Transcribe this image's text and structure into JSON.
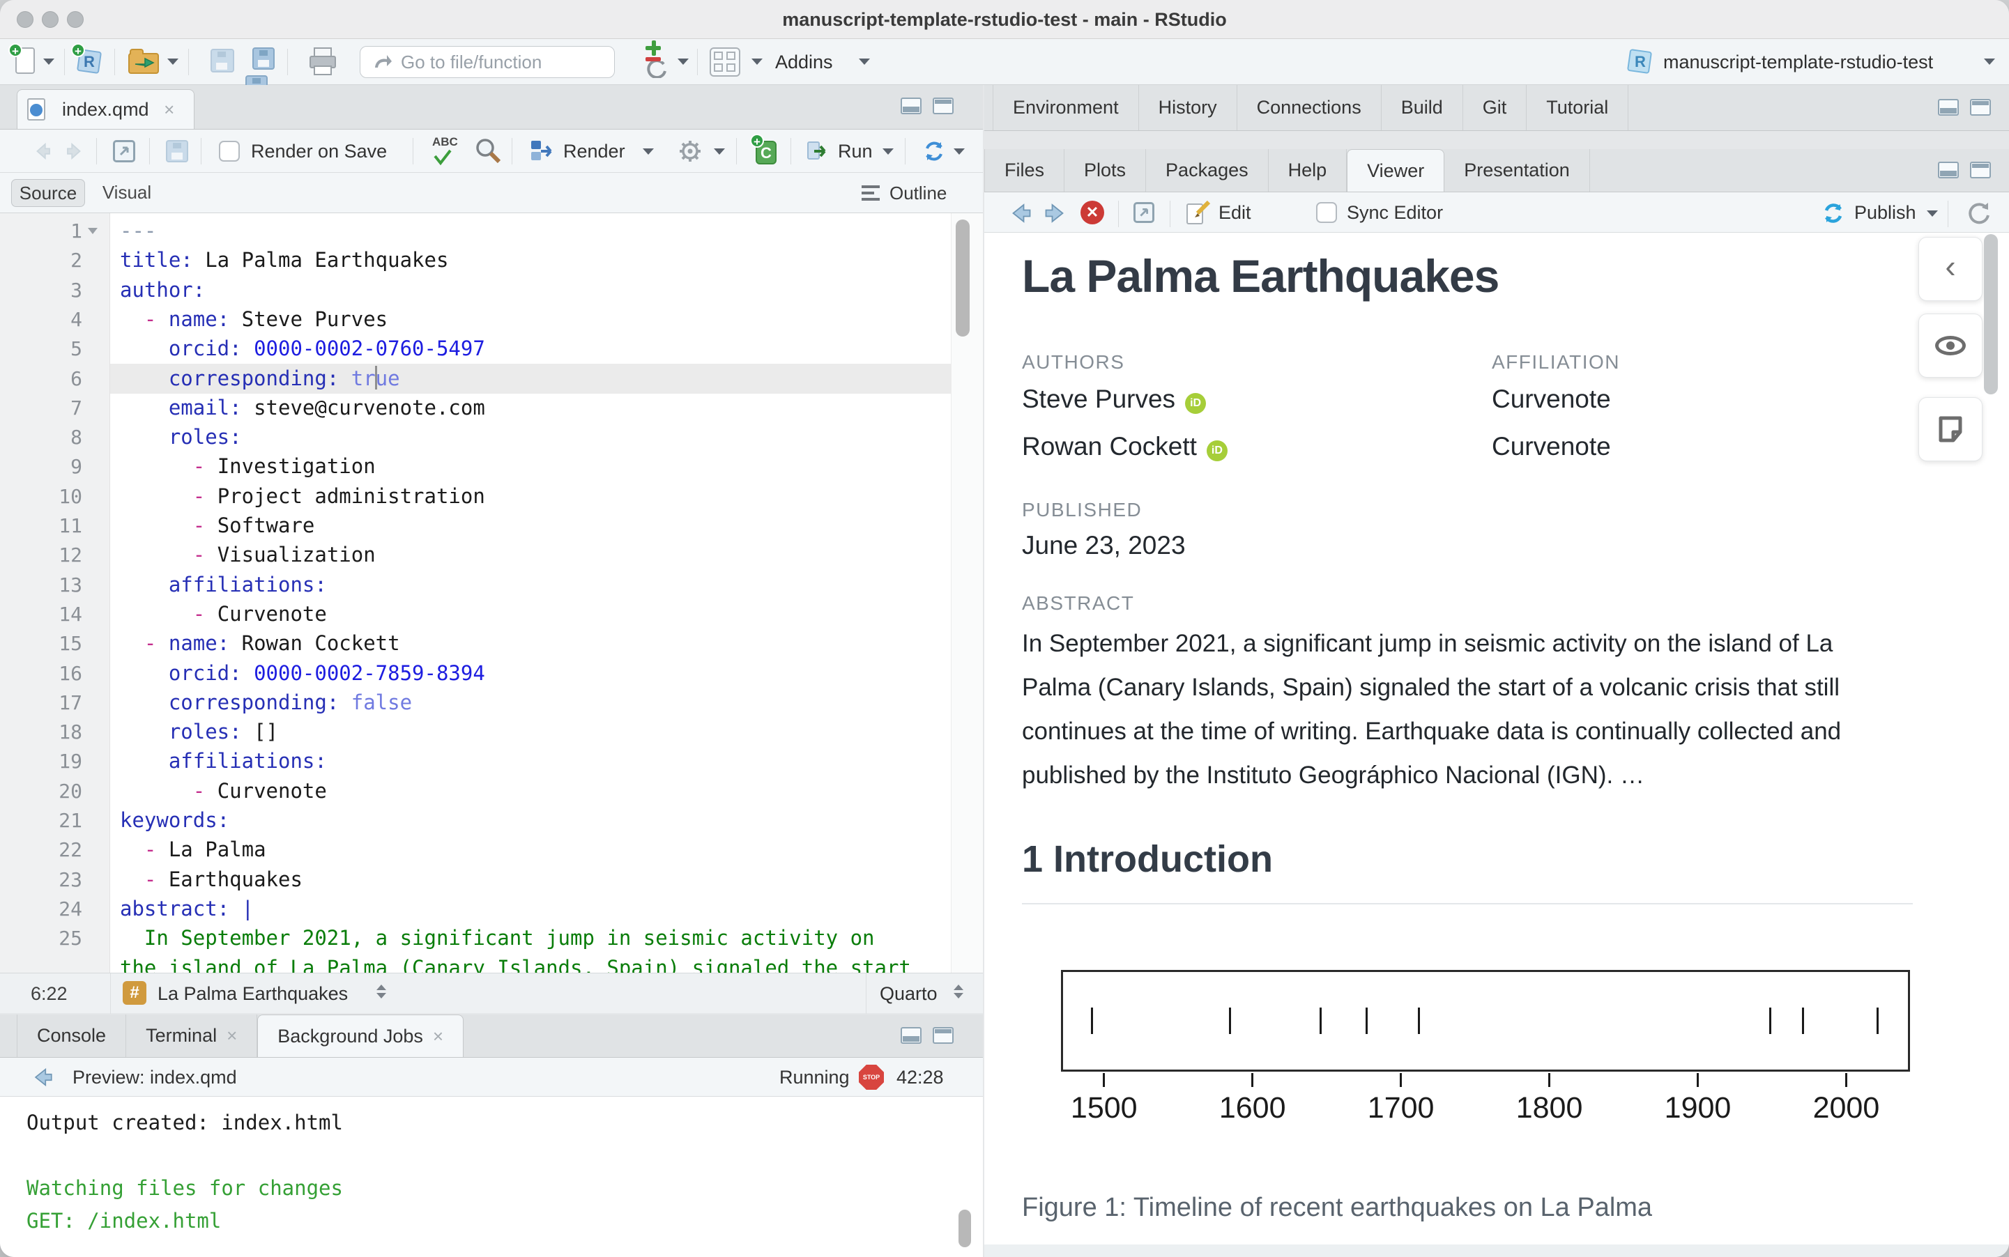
{
  "window": {
    "title": "manuscript-template-rstudio-test - main - RStudio"
  },
  "icons": {
    "close": "×",
    "chevron_left": "‹",
    "caret": "▾"
  },
  "colors": {
    "render_blue": "#4178bc",
    "publish_blue": "#2aa3dc",
    "orcid_green": "#a6ce39",
    "stop_red": "#d8453f",
    "console_green": "#35a035",
    "key_blue": "#262fb5",
    "dash_magenta": "#c42f8e",
    "string_green": "#0a7d0a"
  },
  "toolbar": {
    "goto_placeholder": "Go to file/function",
    "addins_label": "Addins",
    "project_label": "manuscript-template-rstudio-test"
  },
  "editor": {
    "tab_label": "index.qmd",
    "toolbar": {
      "render_on_save": "Render on Save",
      "spell": "ABC",
      "render_label": "Render",
      "run_label": "Run"
    },
    "views": {
      "source": "Source",
      "visual": "Visual",
      "outline_label": "Outline"
    },
    "status": {
      "position": "6:22",
      "badge": "#",
      "section": "La Palma Earthquakes",
      "mode": "Quarto"
    },
    "lines": [
      {
        "n": "1",
        "fold": true,
        "segs": [
          [
            "m",
            "---"
          ]
        ]
      },
      {
        "n": "2",
        "segs": [
          [
            "k",
            "title:"
          ],
          [
            "p",
            " La Palma Earthquakes"
          ]
        ]
      },
      {
        "n": "3",
        "segs": [
          [
            "k",
            "author:"
          ]
        ]
      },
      {
        "n": "4",
        "segs": [
          [
            "p",
            "  "
          ],
          [
            "d",
            "-"
          ],
          [
            "p",
            " "
          ],
          [
            "k",
            "name:"
          ],
          [
            "p",
            " Steve Purves"
          ]
        ]
      },
      {
        "n": "5",
        "segs": [
          [
            "p",
            "    "
          ],
          [
            "k",
            "orcid:"
          ],
          [
            "p",
            " "
          ],
          [
            "n",
            "0000-0002-0760-5497"
          ]
        ]
      },
      {
        "n": "6",
        "active": true,
        "segs": [
          [
            "p",
            "    "
          ],
          [
            "k",
            "corresponding:"
          ],
          [
            "p",
            " "
          ],
          [
            "b",
            "true"
          ]
        ]
      },
      {
        "n": "7",
        "segs": [
          [
            "p",
            "    "
          ],
          [
            "k",
            "email:"
          ],
          [
            "p",
            " steve@curvenote.com"
          ]
        ]
      },
      {
        "n": "8",
        "segs": [
          [
            "p",
            "    "
          ],
          [
            "k",
            "roles:"
          ]
        ]
      },
      {
        "n": "9",
        "segs": [
          [
            "p",
            "      "
          ],
          [
            "d",
            "-"
          ],
          [
            "p",
            " Investigation"
          ]
        ]
      },
      {
        "n": "10",
        "segs": [
          [
            "p",
            "      "
          ],
          [
            "d",
            "-"
          ],
          [
            "p",
            " Project administration"
          ]
        ]
      },
      {
        "n": "11",
        "segs": [
          [
            "p",
            "      "
          ],
          [
            "d",
            "-"
          ],
          [
            "p",
            " Software"
          ]
        ]
      },
      {
        "n": "12",
        "segs": [
          [
            "p",
            "      "
          ],
          [
            "d",
            "-"
          ],
          [
            "p",
            " Visualization"
          ]
        ]
      },
      {
        "n": "13",
        "segs": [
          [
            "p",
            "    "
          ],
          [
            "k",
            "affiliations:"
          ]
        ]
      },
      {
        "n": "14",
        "segs": [
          [
            "p",
            "      "
          ],
          [
            "d",
            "-"
          ],
          [
            "p",
            " Curvenote"
          ]
        ]
      },
      {
        "n": "15",
        "segs": [
          [
            "p",
            "  "
          ],
          [
            "d",
            "-"
          ],
          [
            "p",
            " "
          ],
          [
            "k",
            "name:"
          ],
          [
            "p",
            " Rowan Cockett"
          ]
        ]
      },
      {
        "n": "16",
        "segs": [
          [
            "p",
            "    "
          ],
          [
            "k",
            "orcid:"
          ],
          [
            "p",
            " "
          ],
          [
            "n",
            "0000-0002-7859-8394"
          ]
        ]
      },
      {
        "n": "17",
        "segs": [
          [
            "p",
            "    "
          ],
          [
            "k",
            "corresponding:"
          ],
          [
            "p",
            " "
          ],
          [
            "b",
            "false"
          ]
        ]
      },
      {
        "n": "18",
        "segs": [
          [
            "p",
            "    "
          ],
          [
            "k",
            "roles:"
          ],
          [
            "p",
            " []"
          ]
        ]
      },
      {
        "n": "19",
        "segs": [
          [
            "p",
            "    "
          ],
          [
            "k",
            "affiliations:"
          ]
        ]
      },
      {
        "n": "20",
        "segs": [
          [
            "p",
            "      "
          ],
          [
            "d",
            "-"
          ],
          [
            "p",
            " Curvenote"
          ]
        ]
      },
      {
        "n": "21",
        "segs": [
          [
            "k",
            "keywords:"
          ]
        ]
      },
      {
        "n": "22",
        "segs": [
          [
            "p",
            "  "
          ],
          [
            "d",
            "-"
          ],
          [
            "p",
            " La Palma"
          ]
        ]
      },
      {
        "n": "23",
        "segs": [
          [
            "p",
            "  "
          ],
          [
            "d",
            "-"
          ],
          [
            "p",
            " Earthquakes"
          ]
        ]
      },
      {
        "n": "24",
        "segs": [
          [
            "k",
            "abstract:"
          ],
          [
            "p",
            " "
          ],
          [
            "k",
            "|"
          ]
        ]
      },
      {
        "n": "25",
        "segs": [
          [
            "g",
            "  In September 2021, a significant jump in seismic activity on"
          ]
        ]
      },
      {
        "n": "",
        "segs": [
          [
            "g",
            "the island of La Palma (Canary Islands, Spain) signaled the start"
          ]
        ]
      }
    ]
  },
  "console": {
    "tabs": [
      {
        "label": "Console",
        "closable": false,
        "active": false
      },
      {
        "label": "Terminal",
        "closable": true,
        "active": false
      },
      {
        "label": "Background Jobs",
        "closable": true,
        "active": true
      }
    ],
    "preview_label": "Preview: index.qmd",
    "running_label": "Running",
    "stop_label": "STOP",
    "time": "42:28",
    "output": [
      {
        "text": "Output created: index.html",
        "color": "dark"
      },
      {
        "text": "",
        "color": "dark"
      },
      {
        "text": "Watching files for changes",
        "color": "green"
      },
      {
        "text": "GET: /index.html",
        "color": "green"
      }
    ]
  },
  "right": {
    "top_tabs": [
      "Environment",
      "History",
      "Connections",
      "Build",
      "Git",
      "Tutorial"
    ]
  },
  "viewer": {
    "tabs": [
      "Files",
      "Plots",
      "Packages",
      "Help",
      "Viewer",
      "Presentation"
    ],
    "toolbar": {
      "edit_label": "Edit",
      "sync_label": "Sync Editor",
      "publish_label": "Publish"
    },
    "doc": {
      "title": "La Palma Earthquakes",
      "authors_label": "AUTHORS",
      "affiliation_label": "AFFILIATION",
      "orcid_badge": "iD",
      "authors": [
        {
          "name": "Steve Purves",
          "affiliation": "Curvenote"
        },
        {
          "name": "Rowan Cockett",
          "affiliation": "Curvenote"
        }
      ],
      "published_label": "PUBLISHED",
      "published": "June 23, 2023",
      "abstract_label": "ABSTRACT",
      "abstract": "In September 2021, a significant jump in seismic activity on the island of La Palma (Canary Islands, Spain) signaled the start of a volcanic crisis that still continues at the time of writing. Earthquake data is continually collected and published by the Instituto Geográphico Nacional (IGN). …",
      "section_heading": "1 Introduction"
    },
    "figure": {
      "type": "rug-timeline",
      "events": [
        1492,
        1585,
        1646,
        1677,
        1712,
        1949,
        1971,
        2021
      ],
      "axis_ticks": [
        1500,
        1600,
        1700,
        1800,
        1900,
        2000
      ],
      "xlim": [
        1471,
        2043
      ],
      "caption": "Figure 1: Timeline of recent earthquakes on La Palma"
    }
  }
}
